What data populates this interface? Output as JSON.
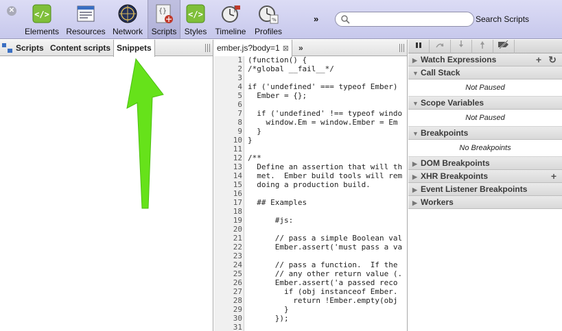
{
  "toolbar": {
    "items": [
      {
        "label": "Elements",
        "icon": "elements-icon"
      },
      {
        "label": "Resources",
        "icon": "resources-icon"
      },
      {
        "label": "Network",
        "icon": "network-icon"
      },
      {
        "label": "Scripts",
        "icon": "scripts-icon",
        "selected": true
      },
      {
        "label": "Styles",
        "icon": "styles-icon"
      },
      {
        "label": "Timeline",
        "icon": "timeline-icon"
      },
      {
        "label": "Profiles",
        "icon": "profiles-icon"
      }
    ],
    "more": "»",
    "search_placeholder": "",
    "search_label": "Search Scripts"
  },
  "left_panel": {
    "tabs": [
      "Scripts",
      "Content scripts",
      "Snippets"
    ],
    "active_tab": "Snippets"
  },
  "editor": {
    "file_name": "ember.js?body=1",
    "close_glyph": "⊠",
    "more": "»",
    "lines": [
      "(function() {",
      "/*global __fail__*/",
      "",
      "if ('undefined' === typeof Ember)",
      "  Ember = {};",
      "",
      "  if ('undefined' !== typeof windo",
      "    window.Em = window.Ember = Em",
      "  }",
      "}",
      "",
      "/**",
      "  Define an assertion that will th",
      "  met.  Ember build tools will rem",
      "  doing a production build.",
      "",
      "  ## Examples",
      "",
      "      #js:",
      "",
      "      // pass a simple Boolean val",
      "      Ember.assert('must pass a va",
      "",
      "      // pass a function.  If the",
      "      // any other return value (.",
      "      Ember.assert('a passed reco",
      "        if (obj instanceof Ember.",
      "          return !Ember.empty(obj",
      "        }",
      "      });",
      ""
    ]
  },
  "sidebar": {
    "sections": [
      {
        "title": "Watch Expressions",
        "expanded": false,
        "actions": [
          "+",
          "↻"
        ],
        "body": ""
      },
      {
        "title": "Call Stack",
        "expanded": true,
        "actions": [],
        "body": "Not Paused"
      },
      {
        "title": "Scope Variables",
        "expanded": true,
        "actions": [],
        "body": "Not Paused"
      },
      {
        "title": "Breakpoints",
        "expanded": true,
        "actions": [],
        "body": "No Breakpoints"
      },
      {
        "title": "DOM Breakpoints",
        "expanded": false,
        "actions": [],
        "body": ""
      },
      {
        "title": "XHR Breakpoints",
        "expanded": false,
        "actions": [
          "+"
        ],
        "body": ""
      },
      {
        "title": "Event Listener Breakpoints",
        "expanded": false,
        "actions": [],
        "body": ""
      },
      {
        "title": "Workers",
        "expanded": false,
        "actions": [],
        "body": ""
      }
    ]
  },
  "colors": {
    "toolbar_bg": "#c7c8ec",
    "annotation_arrow": "#66e21a"
  }
}
